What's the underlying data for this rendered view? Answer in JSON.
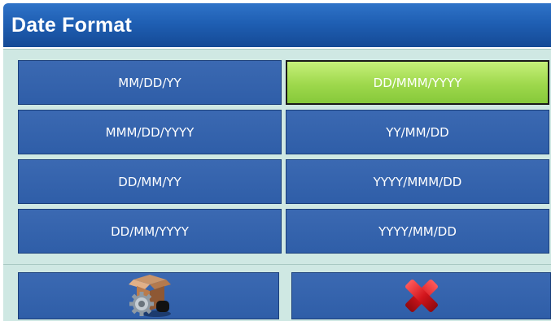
{
  "window": {
    "title": "Date Format"
  },
  "options": [
    {
      "label": "MM/DD/YY",
      "selected": false
    },
    {
      "label": "DD/MMM/YYYY",
      "selected": true
    },
    {
      "label": "MMM/DD/YYYY",
      "selected": false
    },
    {
      "label": "YY/MM/DD",
      "selected": false
    },
    {
      "label": "DD/MM/YY",
      "selected": false
    },
    {
      "label": "YYYY/MMM/DD",
      "selected": false
    },
    {
      "label": "DD/MM/YYYY",
      "selected": false
    },
    {
      "label": "YYYY/MM/DD",
      "selected": false
    }
  ],
  "softkeys": {
    "left_icon": "settings-box-icon",
    "right_icon": "cancel-x-icon"
  },
  "colors": {
    "title_bar": "#1f5fb3",
    "button_blue": "#2f5ea8",
    "selected_green": "#9ed84c",
    "panel_bg": "#cfe8e3",
    "cancel_red": "#d2141b"
  }
}
